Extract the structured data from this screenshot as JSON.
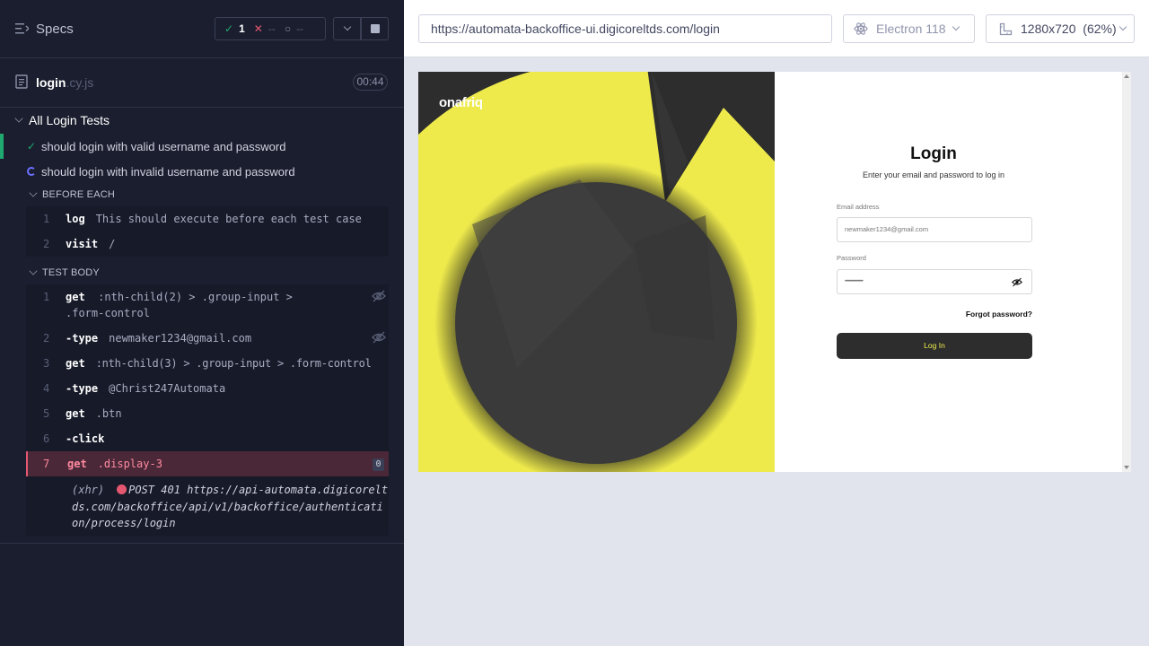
{
  "reporter": {
    "header": {
      "title": "Specs",
      "passed": "1",
      "failed": "--",
      "pending": "--"
    },
    "spec": {
      "name": "login",
      "ext": ".cy.js",
      "duration": "00:44"
    },
    "suite": "All Login Tests",
    "tests": [
      {
        "title": "should login with valid username and password",
        "state": "passed"
      },
      {
        "title": "should login with invalid username and password",
        "state": "running"
      }
    ],
    "before_each": {
      "title": "BEFORE EACH",
      "commands": [
        {
          "num": "1",
          "name": "log",
          "msg": "This should execute before each test case"
        },
        {
          "num": "2",
          "name": "visit",
          "msg": "/"
        }
      ]
    },
    "test_body": {
      "title": "TEST BODY",
      "commands": [
        {
          "num": "1",
          "name": "get",
          "msg": ":nth-child(2) > .group-input > .form-control"
        },
        {
          "num": "2",
          "name": "-type",
          "msg": "newmaker1234@gmail.com"
        },
        {
          "num": "3",
          "name": "get",
          "msg": ":nth-child(3) > .group-input > .form-control"
        },
        {
          "num": "4",
          "name": "-type",
          "msg": "@Christ247Automata"
        },
        {
          "num": "5",
          "name": "get",
          "msg": ".btn"
        },
        {
          "num": "6",
          "name": "-click",
          "msg": ""
        },
        {
          "num": "7",
          "name": "get",
          "msg": ".display-3",
          "badge": "0"
        }
      ],
      "xhr": {
        "tag": "(xhr)",
        "text": "POST 401 https://api-automata.digicoreltds.com/backoffice/api/v1/backoffice/authentication/process/login"
      }
    }
  },
  "topbar": {
    "url": "https://automata-backoffice-ui.digicoreltds.com/login",
    "browser": "Electron 118",
    "viewport": "1280x720",
    "zoom": "(62%)"
  },
  "app": {
    "brand": "onafriq",
    "title": "Login",
    "subtitle": "Enter your email and password to log in",
    "email_label": "Email address",
    "email_value": "newmaker1234@gmail.com",
    "password_label": "Password",
    "password_value": "••••••••••••••••••",
    "forgot": "Forgot password?",
    "button": "Log In"
  },
  "colors": {
    "accent_yellow": "#f0ec4e",
    "pass_green": "#1fa971",
    "fail_red": "#e45770",
    "reporter_bg": "#1b1e2e"
  }
}
